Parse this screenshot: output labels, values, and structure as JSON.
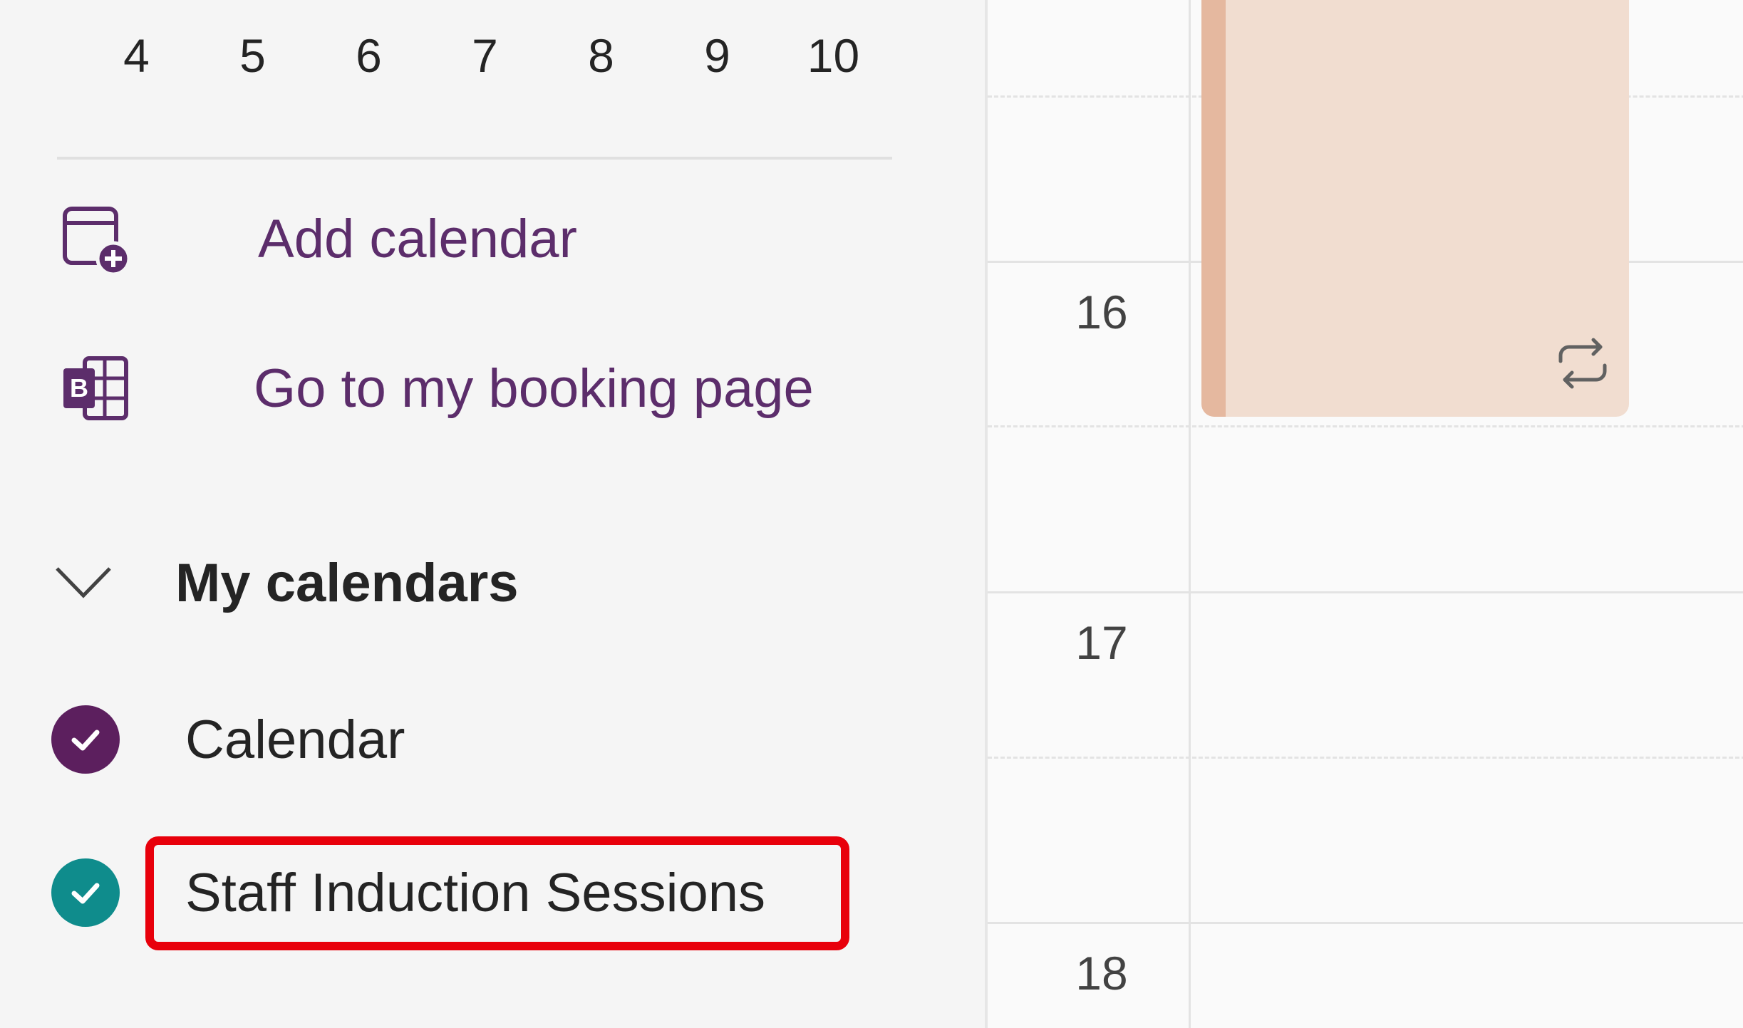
{
  "mini_calendar": {
    "days": [
      "4",
      "5",
      "6",
      "7",
      "8",
      "9",
      "10"
    ]
  },
  "links": {
    "add_calendar": "Add calendar",
    "booking_page": "Go to my booking page"
  },
  "my_calendars": {
    "header": "My calendars",
    "items": [
      {
        "label": "Calendar",
        "color": "#5c1f5e",
        "checked": true
      },
      {
        "label": "Staff Induction Sessions",
        "color": "#0f8c8c",
        "checked": true
      }
    ]
  },
  "grid": {
    "hours": [
      "16",
      "17",
      "18"
    ],
    "event": {
      "color": "#f1ddd0",
      "accent": "#e5b89f",
      "icon": "repeat-icon"
    }
  },
  "colors": {
    "link_text": "#5c2d6b",
    "highlight": "#e8000b"
  }
}
